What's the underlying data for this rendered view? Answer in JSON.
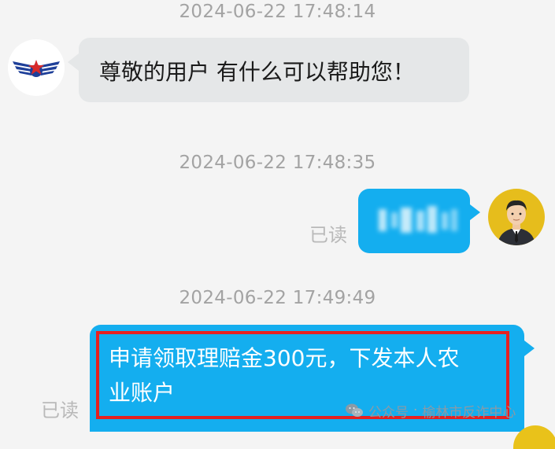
{
  "messages": [
    {
      "timestamp": "2024-06-22 17:48:14",
      "direction": "incoming",
      "text": "尊敬的用户 有什么可以帮助您！",
      "sender_avatar": "airline-logo-icon"
    },
    {
      "timestamp": "2024-06-22 17:48:35",
      "direction": "outgoing",
      "read_status": "已读",
      "text_redacted": true,
      "sender_avatar": "user-avatar-icon"
    },
    {
      "timestamp": "2024-06-22 17:49:49",
      "direction": "outgoing",
      "read_status": "已读",
      "text_line1": "申请领取理赔金300元，下发本人农",
      "text_line2": "业账户"
    }
  ],
  "watermark": {
    "label": "公众号",
    "separator": "·",
    "account": "榆林市反诈中心",
    "icon": "wechat-icon"
  },
  "colors": {
    "background": "#f4f4f4",
    "incoming_bubble": "#e5e7e8",
    "outgoing_bubble": "#14aeef",
    "highlight": "#e62020",
    "timestamp": "#a3a3a3"
  }
}
